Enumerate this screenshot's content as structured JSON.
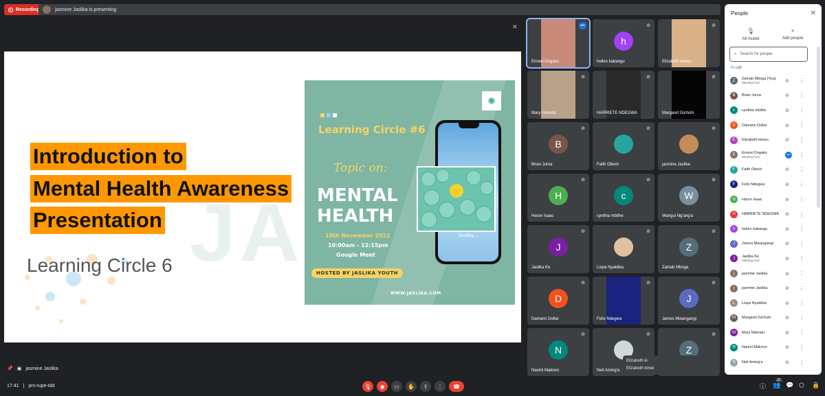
{
  "topbar": {
    "recording_label": "Recording",
    "presenting_text": "jasmine Jaslika is presenting"
  },
  "slide": {
    "title_line1": "Introduction to",
    "title_line2": "Mental Health Awareness",
    "title_line3": "Presentation",
    "subtitle": "Learning Circle 6",
    "background_text": "JAS"
  },
  "poster": {
    "heading": "Learning Circle #6",
    "topic": "Topic on:",
    "subject_line1": "MENTAL",
    "subject_line2": "HEALTH",
    "date": "18th November 2022",
    "time": "10:00am - 12:15pm",
    "platform": "Google Meet",
    "hosted": "HOSTED BY JASLIKA YOUTH",
    "url": "WWW.JASLIKA.COM",
    "phone_status": "Sending ..."
  },
  "tiles": [
    {
      "name": "Ernest Ongako",
      "kind": "photo",
      "color": "#c98a7a"
    },
    {
      "name": "hellen kabangu",
      "kind": "letter",
      "letter": "h",
      "color": "#a142f4"
    },
    {
      "name": "Elizabeth kimeu",
      "kind": "photo",
      "color": "#d9b28a"
    },
    {
      "name": "Mary Ndondu",
      "kind": "photo",
      "color": "#b9a089"
    },
    {
      "name": "HARRIETE NDEGWA",
      "kind": "photo",
      "color": "#2a2a2a"
    },
    {
      "name": "Margaret Gichuhi",
      "kind": "photo",
      "color": "#050505"
    },
    {
      "name": "Brian Juma",
      "kind": "letter",
      "letter": "B",
      "color": "#795548"
    },
    {
      "name": "Faith Oliech",
      "kind": "small-photo",
      "color": "#26a69a"
    },
    {
      "name": "jasmine Jaslika",
      "kind": "small-photo",
      "color": "#c48c5a"
    },
    {
      "name": "Haron Isaac",
      "kind": "letter",
      "letter": "H",
      "color": "#4caf50"
    },
    {
      "name": "cynthia mbithe",
      "kind": "letter",
      "letter": "c",
      "color": "#00897b"
    },
    {
      "name": "Wangui Ng'ang'a",
      "kind": "letter",
      "letter": "W",
      "color": "#78909c"
    },
    {
      "name": "Jaslika Ke",
      "kind": "letter",
      "letter": "J",
      "color": "#7b1fa2"
    },
    {
      "name": "Lispa Nyakibia",
      "kind": "small-photo",
      "color": "#e0c0a0"
    },
    {
      "name": "Zainab Mboga",
      "kind": "letter",
      "letter": "Z",
      "color": "#546e7a"
    },
    {
      "name": "Damaris Dollar",
      "kind": "letter",
      "letter": "D",
      "color": "#f4511e"
    },
    {
      "name": "Felix Ndegwa",
      "kind": "photo",
      "color": "#1a237e"
    },
    {
      "name": "James Mwangangi",
      "kind": "letter",
      "letter": "J",
      "color": "#5c6bc0"
    },
    {
      "name": "Naomi Makovo",
      "kind": "letter",
      "letter": "N",
      "color": "#00897b"
    },
    {
      "name": "Neil Aming'a",
      "kind": "small-photo",
      "color": "#cfd8dc"
    },
    {
      "name": "",
      "kind": "letter",
      "letter": "Z",
      "color": "#546e7a"
    }
  ],
  "tooltip": {
    "line1": "Elizabeth ki",
    "line2": "Elizabeth kimei"
  },
  "people": {
    "title": "People",
    "all_muted": "All muted",
    "add_people": "Add people",
    "search_placeholder": "Search for people",
    "in_call": "In call",
    "list": [
      {
        "name": "Zainab Mboga (You)",
        "sub": "Meeting host",
        "letter": "Z",
        "color": "#546e7a"
      },
      {
        "name": "Brian Juma",
        "sub": "",
        "letter": "B",
        "color": "#795548"
      },
      {
        "name": "cynthia mbithe",
        "sub": "",
        "letter": "c",
        "color": "#00897b"
      },
      {
        "name": "Damaris Dollar",
        "sub": "",
        "letter": "D",
        "color": "#f4511e"
      },
      {
        "name": "Elizabeth kimeu",
        "sub": "",
        "letter": "E",
        "color": "#ab47bc"
      },
      {
        "name": "Ernest Ongako",
        "sub": "Meeting host",
        "letter": "E",
        "color": "#8d6e63",
        "speaking": true
      },
      {
        "name": "Faith Oliech",
        "sub": "",
        "letter": "F",
        "color": "#26a69a"
      },
      {
        "name": "Felix Ndegwa",
        "sub": "",
        "letter": "F",
        "color": "#1a237e"
      },
      {
        "name": "Haron Isaac",
        "sub": "",
        "letter": "H",
        "color": "#4caf50"
      },
      {
        "name": "HARRIETE NDEGWA",
        "sub": "",
        "letter": "H",
        "color": "#e53935"
      },
      {
        "name": "hellen kabangu",
        "sub": "",
        "letter": "h",
        "color": "#a142f4"
      },
      {
        "name": "James Mwangangi",
        "sub": "",
        "letter": "J",
        "color": "#5c6bc0"
      },
      {
        "name": "Jaslika Ke",
        "sub": "Meeting host",
        "letter": "J",
        "color": "#7b1fa2"
      },
      {
        "name": "jasmine Jaslika",
        "sub": "",
        "letter": "j",
        "color": "#8d6e63"
      },
      {
        "name": "jasmine Jaslika",
        "sub": "",
        "letter": "j",
        "color": "#8d6e63"
      },
      {
        "name": "Lispa Nyakibia",
        "sub": "",
        "letter": "L",
        "color": "#a1887f"
      },
      {
        "name": "Margaret Gichuhi",
        "sub": "",
        "letter": "M",
        "color": "#616161"
      },
      {
        "name": "Mary Ndondu",
        "sub": "",
        "letter": "M",
        "color": "#7b1fa2"
      },
      {
        "name": "Naomi Makovo",
        "sub": "",
        "letter": "N",
        "color": "#00897b"
      },
      {
        "name": "Neil Aming'a",
        "sub": "",
        "letter": "N",
        "color": "#90a4ae"
      }
    ]
  },
  "bottom": {
    "presenter": "jasmine Jaslika",
    "time": "17:41",
    "meeting_code": "prs-rupe-tdd",
    "people_count": "22"
  }
}
